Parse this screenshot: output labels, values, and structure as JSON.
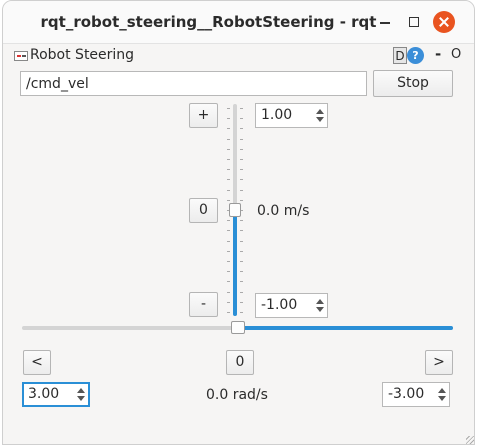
{
  "window": {
    "title": "rqt_robot_steering__RobotSteering - rqt"
  },
  "plugin": {
    "title": "Robot Steering",
    "d_button": "D",
    "help_button": "?",
    "dash_button": "-",
    "o_button": "O"
  },
  "topic": {
    "value": "/cmd_vel"
  },
  "stop_label": "Stop",
  "linear": {
    "increase_label": "+",
    "zero_label": "0",
    "decrease_label": "-",
    "max_value": "1.00",
    "min_value": "-1.00",
    "current_label": "0.0 m/s",
    "slider_value": 0.0
  },
  "angular": {
    "left_label": "<",
    "zero_label": "0",
    "right_label": ">",
    "max_value": "3.00",
    "min_value": "-3.00",
    "current_label": "0.0 rad/s",
    "slider_value": 0.0
  },
  "colors": {
    "accent": "#2a8fd6",
    "close_button": "#e95420"
  }
}
